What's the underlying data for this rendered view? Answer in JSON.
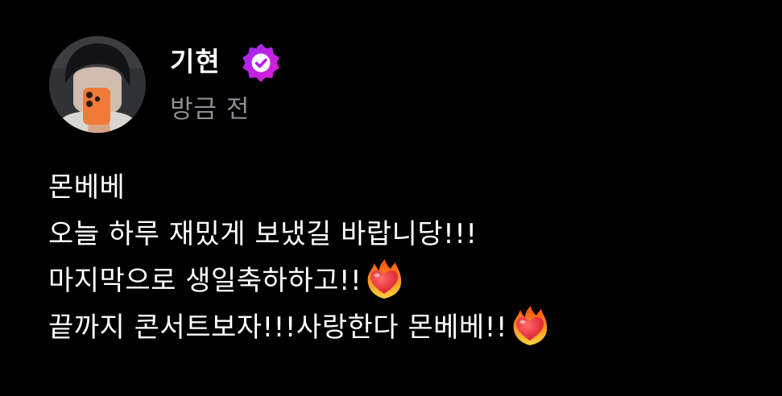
{
  "post": {
    "author": {
      "name": "기현",
      "verified": true,
      "badge_color": "#c21cf0"
    },
    "timestamp": "방금 전",
    "message_lines": [
      {
        "text": "몬베베",
        "emoji": null
      },
      {
        "text": "오늘 하루 재밌게 보냈길 바랍니당!!!",
        "emoji": null
      },
      {
        "text": "마지막으로 생일축하하고!!",
        "emoji": "heart-on-fire"
      },
      {
        "text": "끝까지 콘서트보자!!!사랑한다 몬베베!!",
        "emoji": "heart-on-fire"
      }
    ]
  },
  "colors": {
    "background": "#000000",
    "text": "#ffffff",
    "secondary_text": "#8e8e93"
  }
}
